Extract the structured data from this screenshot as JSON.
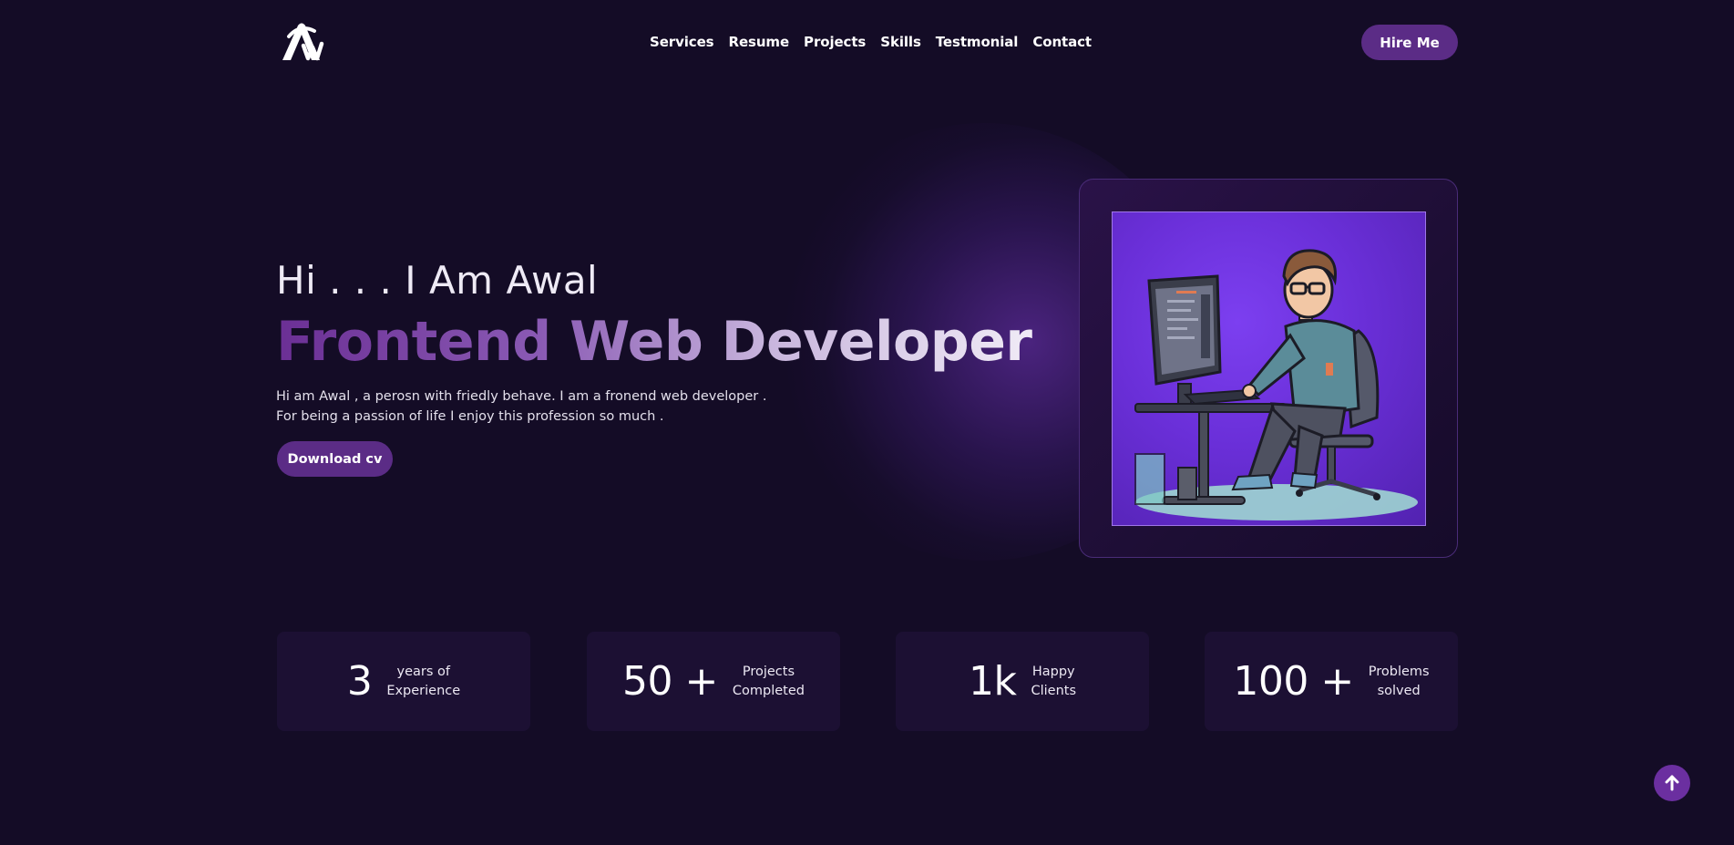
{
  "brand": {
    "logo_text": "Aw"
  },
  "nav": {
    "items": [
      {
        "label": "Services"
      },
      {
        "label": "Resume"
      },
      {
        "label": "Projects"
      },
      {
        "label": "Skills"
      },
      {
        "label": "Testmonial"
      },
      {
        "label": "Contact"
      }
    ]
  },
  "header": {
    "hire_label": "Hire Me"
  },
  "hero": {
    "greeting": "Hi . . . I Am Awal",
    "role": "Frontend Web Developer",
    "bio": "Hi am Awal , a perosn with friedly behave. I am a fronend web developer . For being a passion of life I enjoy this profession so much .",
    "download_label": "Download cv"
  },
  "stats": [
    {
      "value": "3",
      "label": "years of\nExperience"
    },
    {
      "value": "50 +",
      "label": "Projects\nCompleted"
    },
    {
      "value": "1k",
      "label": "Happy\nClients"
    },
    {
      "value": "100 +",
      "label": "Problems\nsolved"
    }
  ],
  "colors": {
    "background": "#140c26",
    "accent": "#5b2c86",
    "card": "#1c1033",
    "photo_bg": "#6a2fd8"
  },
  "icons": {
    "scroll_top": "arrow-up-icon"
  }
}
